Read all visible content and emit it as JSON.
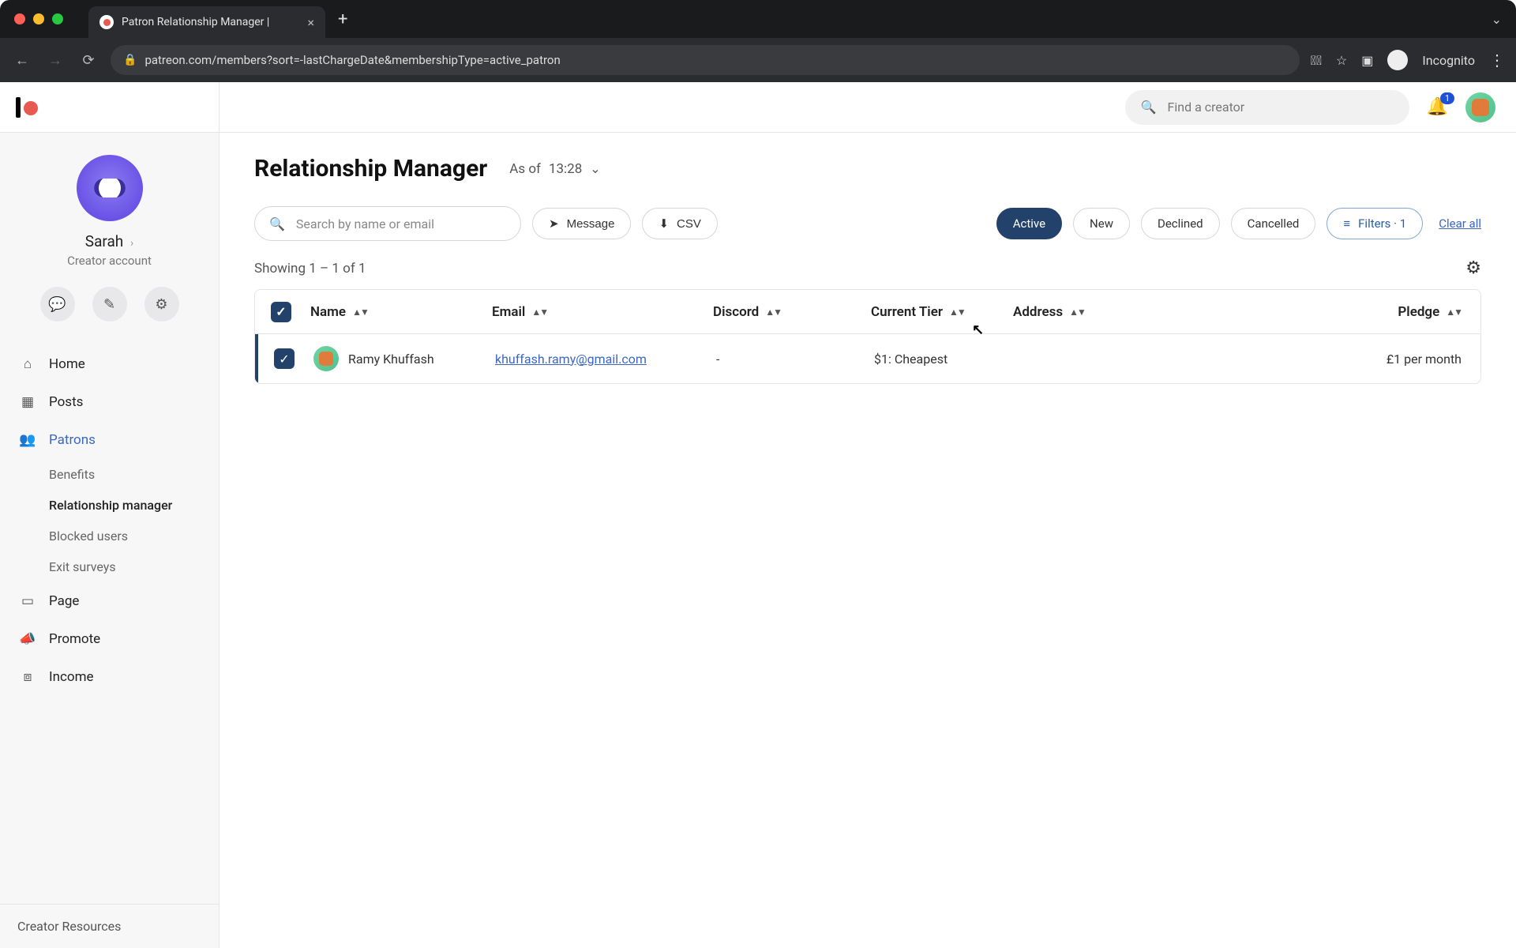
{
  "browser": {
    "tab_title": "Patron Relationship Manager |",
    "url": "patreon.com/members?sort=-lastChargeDate&membershipType=active_patron",
    "incognito_label": "Incognito"
  },
  "sidebar": {
    "creator_name": "Sarah",
    "creator_sub": "Creator account",
    "nav": {
      "home": "Home",
      "posts": "Posts",
      "patrons": "Patrons",
      "benefits": "Benefits",
      "rel_manager": "Relationship manager",
      "blocked": "Blocked users",
      "exit_surveys": "Exit surveys",
      "page": "Page",
      "promote": "Promote",
      "income": "Income"
    },
    "footer": "Creator Resources"
  },
  "topbar": {
    "search_placeholder": "Find a creator",
    "notif_count": "1"
  },
  "page": {
    "title": "Relationship Manager",
    "asof_label": "As of",
    "asof_time": "13:28"
  },
  "toolbar": {
    "search_placeholder": "Search by name or email",
    "message": "Message",
    "csv": "CSV",
    "chips": {
      "active": "Active",
      "new": "New",
      "declined": "Declined",
      "cancelled": "Cancelled"
    },
    "filters_label": "Filters · 1",
    "clear_all": "Clear all"
  },
  "count_text": "Showing 1 – 1 of 1",
  "columns": {
    "name": "Name",
    "email": "Email",
    "discord": "Discord",
    "tier": "Current Tier",
    "address": "Address",
    "pledge": "Pledge"
  },
  "rows": [
    {
      "name": "Ramy Khuffash",
      "email": "khuffash.ramy@gmail.com",
      "discord": "-",
      "tier": "$1: Cheapest",
      "address": "",
      "pledge": "£1 per month"
    }
  ]
}
